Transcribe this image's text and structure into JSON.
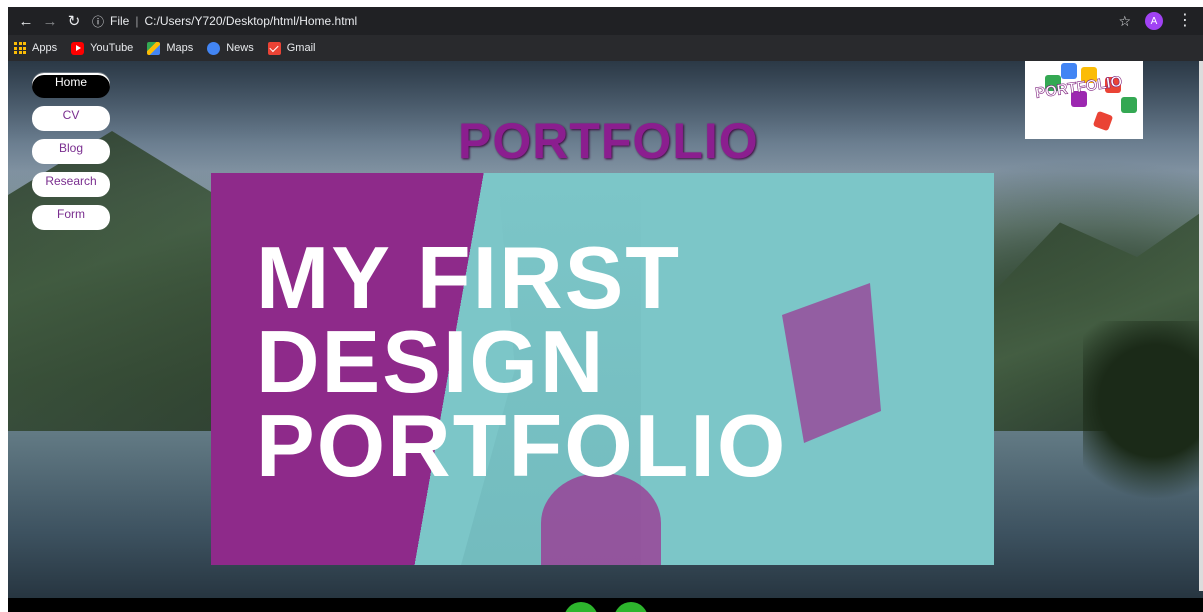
{
  "browser": {
    "address": {
      "info_label": "File",
      "url": "C:/Users/Y720/Desktop/html/Home.html"
    },
    "profile_initial": "A",
    "bookmarks": [
      "Apps",
      "YouTube",
      "Maps",
      "News",
      "Gmail"
    ]
  },
  "nav": {
    "items": [
      {
        "label": "Home",
        "active": true
      },
      {
        "label": "CV",
        "active": false
      },
      {
        "label": "Blog",
        "active": false
      },
      {
        "label": "Research",
        "active": false
      },
      {
        "label": "Form",
        "active": false
      }
    ]
  },
  "page": {
    "heading": "PORTFOLIO",
    "logo_text": "PORTFOLIO",
    "hero_lines": [
      "MY FIRST",
      "DESIGN",
      "PORTFOLIO"
    ]
  },
  "colors": {
    "accent_purple": "#8b1e8f",
    "hero_teal": "#7cc6c8",
    "footer_green": "#2db52d"
  },
  "icons": [
    "back-icon",
    "forward-icon",
    "reload-icon",
    "info-icon",
    "star-icon",
    "menu-icon",
    "apps-icon",
    "youtube-icon",
    "maps-icon",
    "news-icon",
    "gmail-icon"
  ]
}
